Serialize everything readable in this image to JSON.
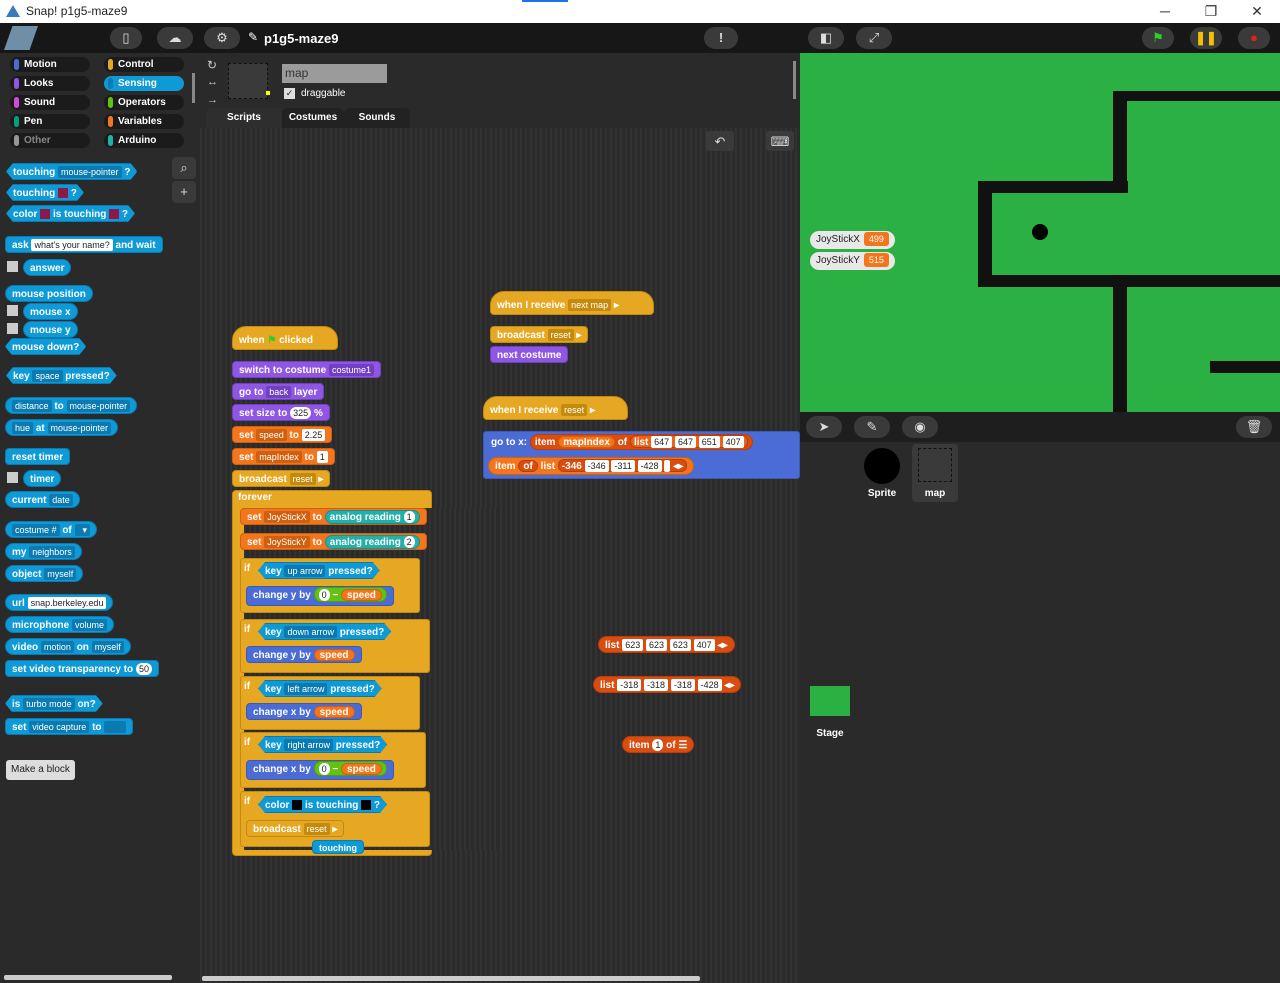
{
  "window": {
    "title": "Snap! p1g5-maze9"
  },
  "project": {
    "name": "p1g5-maze9"
  },
  "categories": [
    {
      "label": "Motion",
      "color": "#4a6cd4"
    },
    {
      "label": "Control",
      "color": "#e6a822"
    },
    {
      "label": "Looks",
      "color": "#8f56e3"
    },
    {
      "label": "Sensing",
      "color": "#0e9ad6"
    },
    {
      "label": "Sound",
      "color": "#cf4ad9"
    },
    {
      "label": "Operators",
      "color": "#62c213"
    },
    {
      "label": "Pen",
      "color": "#00a178"
    },
    {
      "label": "Variables",
      "color": "#f3761d"
    },
    {
      "label": "Other",
      "color": "#969696"
    },
    {
      "label": "Arduino",
      "color": "#24b0a8"
    }
  ],
  "palette": {
    "touching_mouse": [
      "touching",
      "mouse-pointer",
      "?"
    ],
    "touching_color": [
      "touching",
      "?"
    ],
    "color_touching": [
      "color",
      "is touching",
      "?"
    ],
    "ask": [
      "ask",
      "what's your name?",
      "and wait"
    ],
    "answer": "answer",
    "mouse_position": "mouse position",
    "mouse_x": "mouse x",
    "mouse_y": "mouse y",
    "mouse_down": "mouse down?",
    "key_pressed": [
      "key",
      "space",
      "pressed?"
    ],
    "distance": [
      "distance",
      "to",
      "mouse-pointer"
    ],
    "hue": [
      "hue",
      "at",
      "mouse-pointer"
    ],
    "reset_timer": "reset timer",
    "timer": "timer",
    "current_date": [
      "current",
      "date"
    ],
    "attribute": [
      "costume #",
      "of"
    ],
    "my": [
      "my",
      "neighbors"
    ],
    "object": [
      "object",
      "myself"
    ],
    "url": [
      "url",
      "snap.berkeley.edu"
    ],
    "microphone": [
      "microphone",
      "volume"
    ],
    "video": [
      "video",
      "motion",
      "on",
      "myself"
    ],
    "video_transparency": [
      "set video transparency to",
      "50"
    ],
    "turbo": [
      "is",
      "turbo mode",
      "on?"
    ],
    "set_video": [
      "set",
      "video capture",
      "to"
    ],
    "make_block": "Make a block"
  },
  "sprite": {
    "name": "map",
    "draggable_label": "draggable"
  },
  "tabs": [
    "Scripts",
    "Costumes",
    "Sounds"
  ],
  "scripts": {
    "green_flag": {
      "hat": [
        "when",
        "clicked"
      ],
      "switch_costume": [
        "switch to costume",
        "costume1"
      ],
      "go_to": [
        "go to",
        "back",
        "layer"
      ],
      "set_size": [
        "set size to",
        "325",
        "%"
      ],
      "set_speed": [
        "set",
        "speed",
        "to",
        "2.25"
      ],
      "set_mapindex": [
        "set",
        "mapIndex",
        "to",
        "1"
      ],
      "broadcast": [
        "broadcast",
        "reset"
      ],
      "forever": "forever",
      "set_joyx": [
        "set",
        "JoyStickX",
        "to",
        "analog reading",
        "1"
      ],
      "set_joyy": [
        "set",
        "JoyStickY",
        "to",
        "analog reading",
        "2"
      ],
      "if_label": "if",
      "if_up": [
        "key",
        "up arrow",
        "pressed?"
      ],
      "change_y_up": [
        "change y by",
        "0",
        "−",
        "speed"
      ],
      "if_down": [
        "key",
        "down arrow",
        "pressed?"
      ],
      "change_y_down": [
        "change y by",
        "speed"
      ],
      "if_left": [
        "key",
        "left arrow",
        "pressed?"
      ],
      "change_x_left": [
        "change x by",
        "speed"
      ],
      "if_right": [
        "key",
        "right arrow",
        "pressed?"
      ],
      "change_x_right": [
        "change x by",
        "0",
        "−",
        "speed"
      ],
      "if_color": [
        "color",
        "is touching",
        "?"
      ],
      "broadcast2": [
        "broadcast",
        "reset"
      ],
      "touching_fragment": "touching"
    },
    "next_map": {
      "hat": [
        "when I receive",
        "next map"
      ],
      "broadcast": [
        "broadcast",
        "reset"
      ],
      "next_costume": "next costume"
    },
    "reset": {
      "hat": [
        "when I receive",
        "reset"
      ],
      "go_to_xy": [
        "go to x:",
        "item",
        "mapIndex",
        "of",
        "list",
        "647",
        "647",
        "651",
        "407"
      ],
      "item_y": [
        "item",
        "mapIndex",
        "of",
        "list",
        "-346",
        "-346",
        "-311",
        "-428"
      ]
    },
    "loose1": [
      "list",
      "623",
      "623",
      "623",
      "407"
    ],
    "loose2": [
      "list",
      "-318",
      "-318",
      "-318",
      "-428"
    ],
    "loose3": [
      "item",
      "1",
      "of"
    ]
  },
  "stage": {
    "watchers": [
      {
        "label": "JoyStickX",
        "value": "499"
      },
      {
        "label": "JoyStickY",
        "value": "515"
      }
    ]
  },
  "corral": {
    "sprites": [
      "Sprite",
      "map"
    ],
    "stage_label": "Stage"
  }
}
